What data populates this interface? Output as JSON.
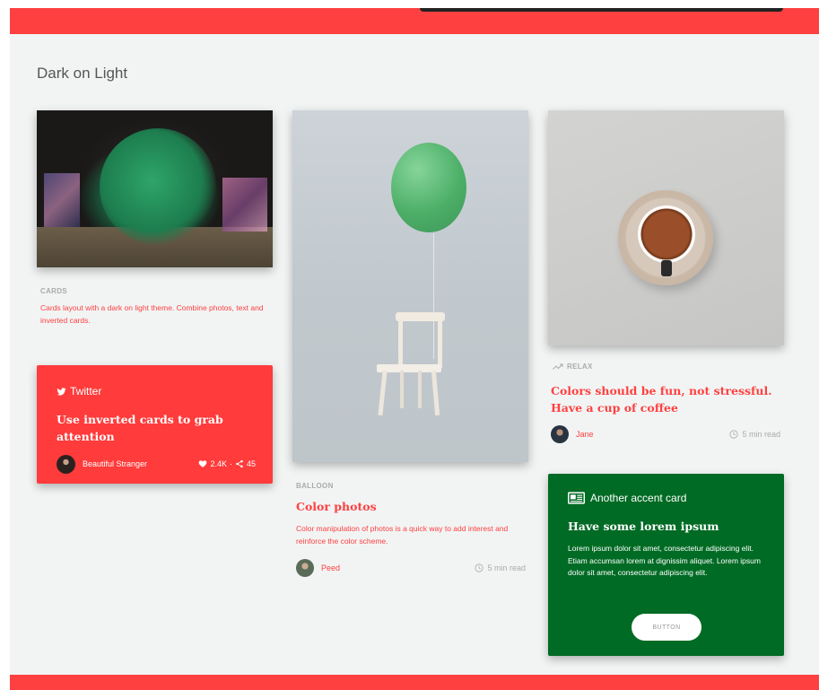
{
  "section": {
    "title": "Dark on Light"
  },
  "colors": {
    "accent": "#ff4040",
    "green_card": "#006b24",
    "page_bg": "#f2f4f4"
  },
  "card_cards": {
    "category": "CARDS",
    "text": "Cards layout with a dark on light theme. Combine photos, text and inverted cards."
  },
  "twitter_card": {
    "icon": "twitter-bird-icon",
    "label": "Twitter",
    "title": "Use inverted cards to grab attention",
    "author": "Beautiful Stranger",
    "likes": "2.4K",
    "separator": "·",
    "shares": "45"
  },
  "balloon_card": {
    "category": "BALLOON",
    "title": "Color photos",
    "text": "Color manipulation of photos is a quick way to add interest and reinforce the color scheme.",
    "author": "Peed",
    "read_time": "5 min read"
  },
  "relax_card": {
    "category": "RELAX",
    "title": "Colors should be fun, not stressful. Have a cup of coffee",
    "author": "Jane",
    "read_time": "5 min read"
  },
  "accent_card": {
    "icon": "newspaper-icon",
    "label": "Another accent card",
    "title": "Have some lorem ipsum",
    "body": "Lorem ipsum dolor sit amet, consectetur adipiscing elit. Etiam accumsan lorem at dignissim aliquet. Lorem ipsum dolor sit amet, consectetur adipiscing elit.",
    "button": "BUTTON"
  }
}
